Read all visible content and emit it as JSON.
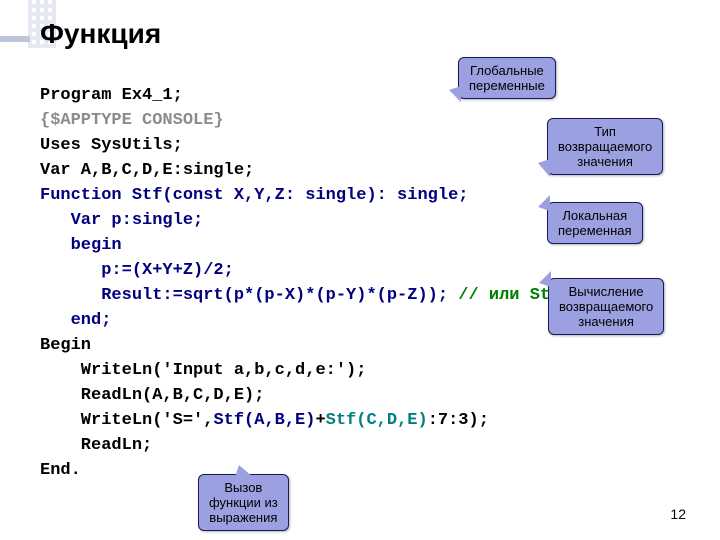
{
  "title": "Функция",
  "code": {
    "l1": "Program Ex4_1;",
    "l2": "{$APPTYPE CONSOLE}",
    "l3": "Uses SysUtils;",
    "l4": "Var A,B,C,D,E:single;",
    "l5": "Function Stf(const X,Y,Z: single): single;",
    "l6": "   Var p:single;",
    "l7": "   begin",
    "l8": "      p:=(X+Y+Z)/2;",
    "l9": "      Result:=sqrt(p*(p-X)*(p-Y)*(p-Z));",
    "l9c": " // или Stf:=..",
    "l10": "   end;",
    "l11": "Begin",
    "l12": "    WriteLn('Input a,b,c,d,e:');",
    "l13": "    ReadLn(A,B,C,D,E);",
    "l14a": "    WriteLn('S=',",
    "l14b": "Stf(A,B,E)",
    "l14c": "+",
    "l14d": "Stf(C,D,E)",
    "l14e": ":7:3);",
    "l15": "    ReadLn;",
    "l16": "End."
  },
  "callouts": {
    "c1a": "Глобальные",
    "c1b": "переменные",
    "c2a": "Тип",
    "c2b": "возвращаемого",
    "c2c": "значения",
    "c3a": "Локальная",
    "c3b": "переменная",
    "c4a": "Вычисление",
    "c4b": "возвращаемого",
    "c4c": "значения",
    "c5a": "Вызов",
    "c5b": "функции из",
    "c5c": "выражения"
  },
  "page": "12"
}
